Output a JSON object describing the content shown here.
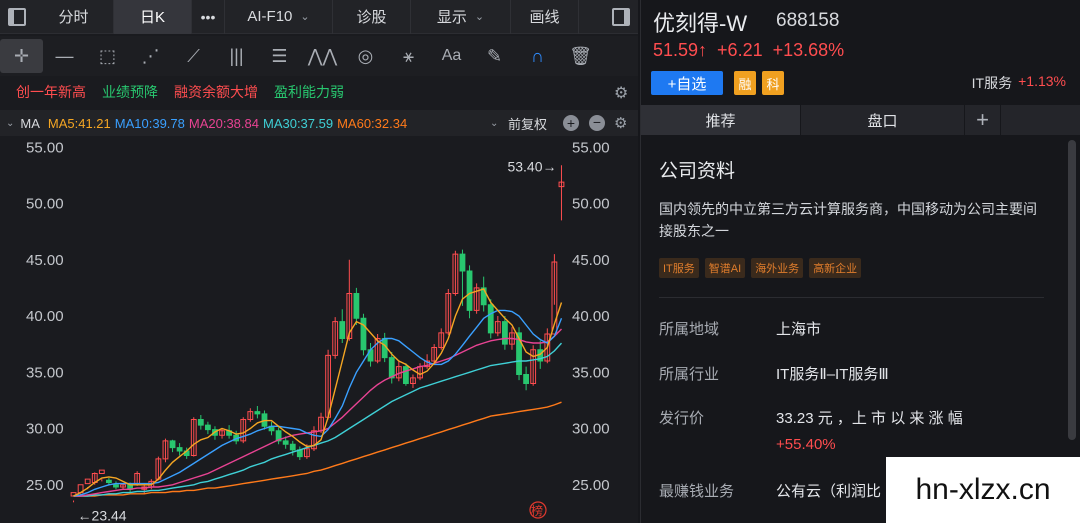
{
  "top_tabs": {
    "fenshi": "分时",
    "rik": "日K",
    "more": "•••",
    "aif10": "AI-F10",
    "zhengu": "诊股",
    "display": "显示",
    "draw": "画线"
  },
  "tags": [
    "创一年新高",
    "业绩预降",
    "融资余额大增",
    "盈利能力弱"
  ],
  "ma": {
    "label": "MA",
    "ma5": "MA5:41.21",
    "ma10": "MA10:39.78",
    "ma20": "MA20:38.84",
    "ma30": "MA30:37.59",
    "ma60": "MA60:32.34",
    "fuquan": "前复权"
  },
  "colors": {
    "up": "#ff4d4f",
    "down": "#28c76f",
    "ma5": "#f5a623",
    "ma10": "#3aa0ff",
    "ma20": "#e84393",
    "ma30": "#3fd0d6",
    "ma60": "#ff7a1a"
  },
  "chart_data": {
    "type": "candlestick",
    "y_ticks": [
      "55.00",
      "50.00",
      "45.00",
      "40.00",
      "35.00",
      "30.00",
      "25.00"
    ],
    "ylim": [
      24,
      56
    ],
    "max_label": "53.40→",
    "min_label": "←23.44",
    "candles": [
      [
        24.0,
        24.3,
        23.6,
        23.44
      ],
      [
        24.3,
        25.0,
        24.2,
        24.1
      ],
      [
        25.1,
        25.5,
        24.8,
        24.6
      ],
      [
        25.2,
        26.0,
        26.1,
        25.0
      ],
      [
        26.0,
        26.3,
        25.5,
        25.3
      ],
      [
        25.4,
        25.2,
        25.6,
        25.0
      ],
      [
        25.0,
        24.8,
        25.3,
        24.6
      ],
      [
        24.8,
        25.0,
        25.1,
        24.6
      ],
      [
        25.0,
        24.6,
        25.2,
        24.3
      ],
      [
        25.1,
        26.0,
        26.2,
        24.9
      ],
      [
        24.6,
        24.8,
        25.0,
        24.2
      ],
      [
        24.8,
        25.3,
        25.5,
        24.6
      ],
      [
        25.5,
        27.3,
        27.5,
        25.4
      ],
      [
        27.3,
        28.9,
        29.1,
        27.0
      ],
      [
        28.9,
        28.3,
        29.0,
        27.9
      ],
      [
        28.3,
        28.0,
        28.7,
        27.6
      ],
      [
        28.0,
        27.6,
        28.3,
        27.3
      ],
      [
        27.6,
        30.8,
        31.0,
        27.5
      ],
      [
        30.8,
        30.3,
        31.2,
        29.9
      ],
      [
        30.3,
        29.9,
        30.6,
        29.5
      ],
      [
        29.9,
        29.4,
        30.2,
        29.0
      ],
      [
        29.4,
        29.8,
        30.0,
        29.1
      ],
      [
        29.8,
        29.4,
        30.3,
        29.1
      ],
      [
        29.4,
        28.9,
        29.8,
        28.6
      ],
      [
        28.9,
        30.8,
        31.0,
        28.7
      ],
      [
        30.8,
        31.5,
        31.8,
        30.6
      ],
      [
        31.5,
        31.3,
        32.0,
        30.9
      ],
      [
        31.3,
        30.2,
        31.6,
        29.9
      ],
      [
        30.2,
        29.8,
        30.6,
        29.4
      ],
      [
        29.8,
        28.9,
        30.1,
        28.6
      ],
      [
        28.9,
        28.6,
        29.3,
        28.2
      ],
      [
        28.6,
        28.1,
        28.9,
        27.6
      ],
      [
        28.1,
        27.5,
        28.4,
        27.2
      ],
      [
        27.5,
        28.2,
        28.6,
        27.3
      ],
      [
        28.2,
        29.8,
        30.2,
        28.0
      ],
      [
        29.8,
        31.0,
        31.4,
        29.6
      ],
      [
        31.0,
        36.5,
        37.0,
        30.8
      ],
      [
        36.5,
        39.5,
        39.9,
        36.2
      ],
      [
        39.5,
        38.0,
        40.6,
        37.6
      ],
      [
        38.0,
        42.0,
        45.0,
        37.8
      ],
      [
        42.0,
        39.8,
        42.5,
        39.2
      ],
      [
        39.8,
        37.0,
        40.2,
        36.5
      ],
      [
        37.0,
        36.0,
        37.6,
        35.5
      ],
      [
        36.0,
        38.0,
        38.4,
        35.8
      ],
      [
        38.0,
        36.3,
        38.5,
        35.9
      ],
      [
        36.3,
        34.5,
        36.8,
        34.0
      ],
      [
        34.5,
        35.5,
        36.0,
        34.2
      ],
      [
        35.5,
        34.0,
        35.8,
        33.8
      ],
      [
        34.0,
        34.5,
        34.8,
        33.6
      ],
      [
        34.5,
        35.5,
        35.8,
        34.3
      ],
      [
        35.5,
        36.0,
        36.6,
        35.3
      ],
      [
        36.0,
        37.2,
        37.5,
        35.8
      ],
      [
        37.2,
        38.5,
        38.9,
        37.0
      ],
      [
        38.5,
        42.0,
        42.4,
        38.3
      ],
      [
        42.0,
        45.5,
        45.8,
        41.8
      ],
      [
        45.5,
        44.0,
        45.9,
        40.9
      ],
      [
        44.0,
        40.5,
        44.5,
        39.8
      ],
      [
        40.5,
        42.5,
        42.9,
        40.2
      ],
      [
        42.5,
        41.0,
        43.5,
        40.4
      ],
      [
        41.0,
        38.5,
        41.5,
        38.0
      ],
      [
        38.5,
        39.5,
        40.0,
        38.2
      ],
      [
        39.5,
        37.5,
        40.0,
        37.0
      ],
      [
        37.5,
        38.5,
        39.0,
        37.0
      ],
      [
        38.5,
        34.8,
        39.0,
        34.3
      ],
      [
        34.8,
        34.0,
        35.5,
        33.4
      ],
      [
        34.0,
        37.0,
        37.4,
        33.8
      ],
      [
        37.0,
        36.0,
        37.8,
        35.3
      ],
      [
        36.0,
        38.4,
        38.9,
        35.8
      ],
      [
        38.4,
        44.8,
        45.5,
        41.0
      ],
      [
        51.5,
        51.9,
        53.4,
        48.5
      ]
    ],
    "ma5": [
      24.0,
      24.3,
      24.7,
      25.2,
      25.6,
      25.7,
      25.6,
      25.3,
      25.0,
      25.0,
      25.0,
      25.0,
      25.5,
      26.3,
      27.0,
      27.5,
      28.0,
      28.6,
      29.0,
      29.2,
      29.7,
      30.0,
      29.8,
      29.5,
      29.6,
      30.0,
      30.5,
      30.7,
      30.7,
      30.2,
      29.7,
      29.3,
      28.8,
      28.4,
      28.5,
      29.0,
      31.0,
      33.5,
      36.0,
      38.5,
      39.5,
      39.2,
      38.5,
      37.8,
      37.4,
      36.6,
      36.0,
      35.7,
      35.2,
      34.8,
      35.1,
      35.8,
      36.7,
      38.0,
      40.0,
      41.5,
      42.0,
      42.2,
      42.4,
      41.2,
      40.5,
      39.8,
      39.2,
      38.0,
      36.8,
      36.4,
      36.6,
      37.2,
      39.3,
      41.2
    ],
    "ma10": [
      24.0,
      24.1,
      24.3,
      24.6,
      24.8,
      25.0,
      25.1,
      25.1,
      25.1,
      25.1,
      25.1,
      25.1,
      25.2,
      25.5,
      25.8,
      26.1,
      26.5,
      26.9,
      27.3,
      27.7,
      28.1,
      28.5,
      28.8,
      29.1,
      29.3,
      29.5,
      29.8,
      30.0,
      30.2,
      30.2,
      30.1,
      30.0,
      29.9,
      29.6,
      29.4,
      29.3,
      29.9,
      30.9,
      32.0,
      33.6,
      35.0,
      36.0,
      37.0,
      37.6,
      38.0,
      38.0,
      37.8,
      37.3,
      36.8,
      36.3,
      35.9,
      35.7,
      35.7,
      36.0,
      36.6,
      37.4,
      38.2,
      39.0,
      39.8,
      40.2,
      40.5,
      40.5,
      40.4,
      40.0,
      39.2,
      38.4,
      37.9,
      37.6,
      38.2,
      39.8
    ],
    "ma20": [
      24.0,
      24.0,
      24.1,
      24.2,
      24.3,
      24.4,
      24.5,
      24.6,
      24.6,
      24.7,
      24.7,
      24.8,
      24.8,
      24.9,
      25.0,
      25.2,
      25.4,
      25.6,
      25.8,
      26.0,
      26.3,
      26.6,
      26.9,
      27.2,
      27.5,
      27.8,
      28.1,
      28.4,
      28.7,
      29.0,
      29.2,
      29.4,
      29.5,
      29.6,
      29.7,
      29.8,
      30.0,
      30.5,
      31.0,
      31.6,
      32.2,
      32.8,
      33.4,
      33.9,
      34.3,
      34.6,
      34.9,
      35.1,
      35.3,
      35.5,
      35.6,
      35.8,
      36.0,
      36.2,
      36.5,
      36.8,
      37.1,
      37.4,
      37.6,
      37.8,
      37.9,
      38.0,
      38.0,
      37.9,
      37.7,
      37.6,
      37.6,
      37.7,
      38.2,
      38.84
    ],
    "ma30": [
      24.0,
      24.0,
      24.0,
      24.1,
      24.1,
      24.2,
      24.2,
      24.3,
      24.3,
      24.4,
      24.4,
      24.5,
      24.5,
      24.6,
      24.7,
      24.8,
      24.9,
      25.0,
      25.2,
      25.3,
      25.5,
      25.7,
      25.9,
      26.1,
      26.3,
      26.6,
      26.8,
      27.0,
      27.3,
      27.5,
      27.7,
      27.9,
      28.1,
      28.3,
      28.5,
      28.7,
      28.9,
      29.2,
      29.6,
      30.0,
      30.4,
      30.8,
      31.2,
      31.6,
      32.0,
      32.4,
      32.7,
      33.0,
      33.3,
      33.6,
      33.8,
      34.0,
      34.2,
      34.4,
      34.6,
      34.8,
      35.0,
      35.2,
      35.4,
      35.6,
      35.7,
      35.8,
      35.9,
      36.0,
      36.0,
      36.1,
      36.2,
      36.4,
      36.9,
      37.59
    ],
    "ma60": [
      24.0,
      24.0,
      24.0,
      24.0,
      24.1,
      24.1,
      24.1,
      24.1,
      24.2,
      24.2,
      24.2,
      24.3,
      24.3,
      24.3,
      24.4,
      24.4,
      24.5,
      24.5,
      24.6,
      24.7,
      24.7,
      24.8,
      24.9,
      25.0,
      25.1,
      25.2,
      25.3,
      25.4,
      25.5,
      25.6,
      25.7,
      25.8,
      25.9,
      26.0,
      26.2,
      26.3,
      26.5,
      26.7,
      26.9,
      27.1,
      27.3,
      27.5,
      27.7,
      27.9,
      28.1,
      28.3,
      28.5,
      28.7,
      28.9,
      29.1,
      29.3,
      29.5,
      29.7,
      29.9,
      30.1,
      30.3,
      30.5,
      30.7,
      30.9,
      31.1,
      31.2,
      31.3,
      31.4,
      31.5,
      31.6,
      31.7,
      31.8,
      31.9,
      32.1,
      32.34
    ]
  },
  "stock": {
    "name": "优刻得-W",
    "code": "688158",
    "price": "51.59↑",
    "change": "+6.21",
    "pct": "+13.68%",
    "add_label": "+自选",
    "badge_rong": "融",
    "badge_ke": "科",
    "industry_name": "IT服务",
    "industry_pct": "+1.13%"
  },
  "right_tabs": {
    "tuijian": "推荐",
    "pankou": "盘口",
    "plus": "+"
  },
  "company": {
    "title": "公司资料",
    "desc": "国内领先的中立第三方云计算服务商，中国移动为公司主要间接股东之一",
    "tags": [
      "IT服务",
      "智谱AI",
      "海外业务",
      "高新企业"
    ],
    "region_k": "所属地域",
    "region_v": "上海市",
    "industry_k": "所属行业",
    "industry_v": "IT服务Ⅱ–IT服务Ⅲ",
    "ipo_k": "发行价",
    "ipo_v": "33.23 元 ，上 市 以 来 涨 幅",
    "ipo_pct": "+55.40%",
    "biz_k": "最赚钱业务",
    "biz_v": "公有云（利润比"
  },
  "watermark": "hn-xlzx.cn",
  "bang": "榜"
}
